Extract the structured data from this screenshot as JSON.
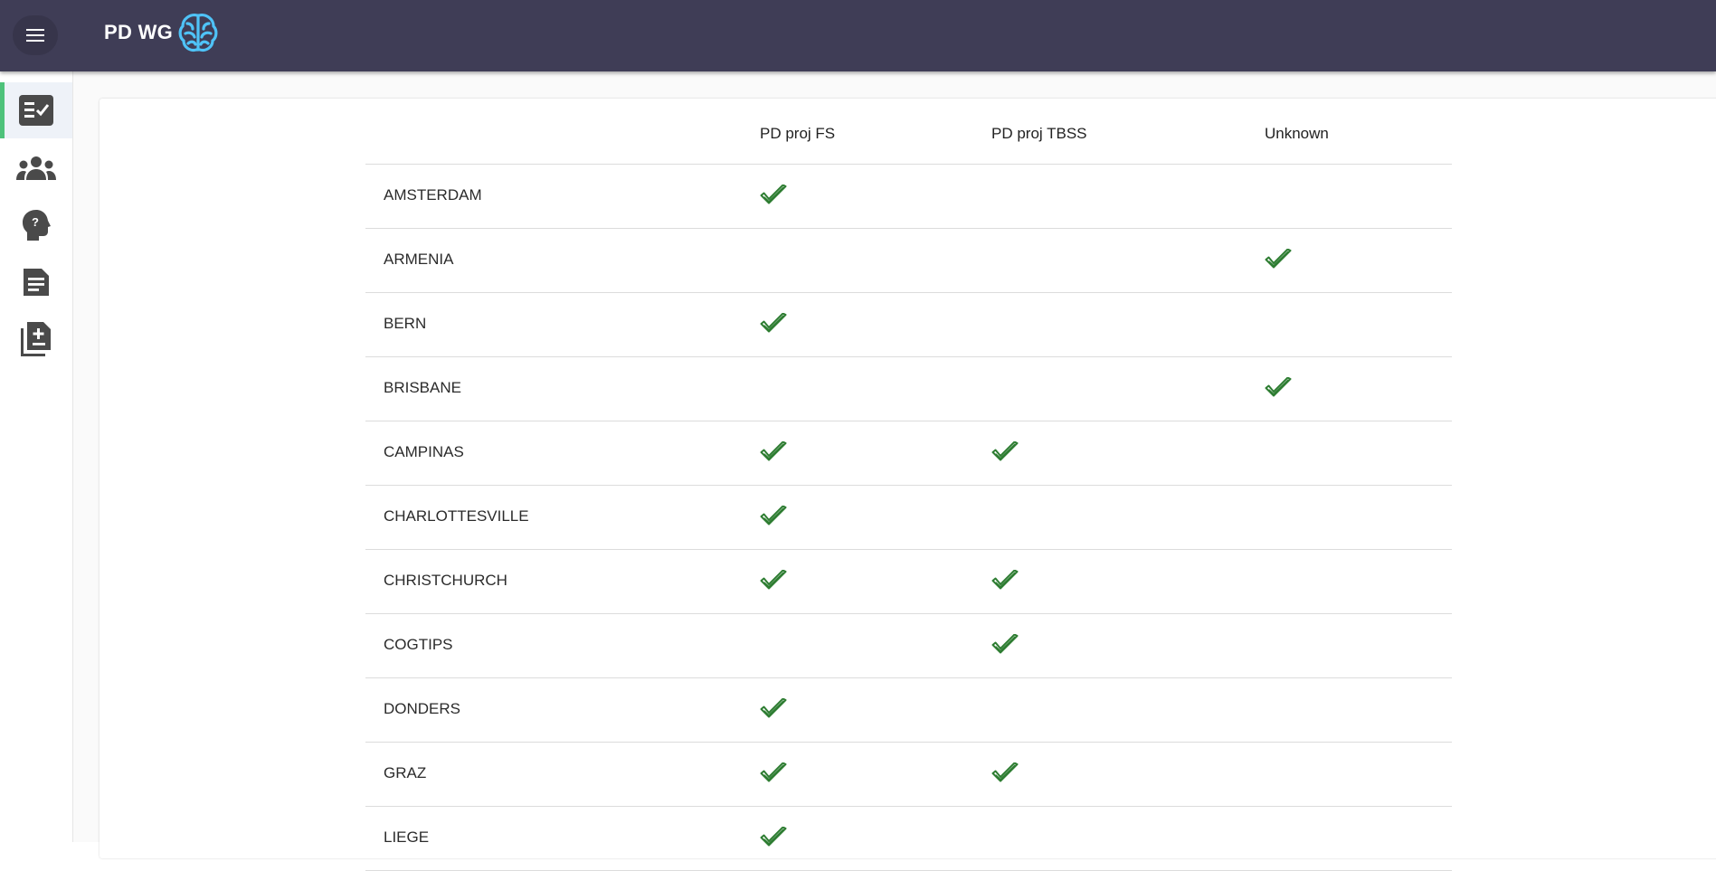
{
  "app": {
    "title": "PD WG"
  },
  "sidebar": {
    "items": [
      {
        "icon": "checklist-icon",
        "active": true
      },
      {
        "icon": "groups-icon",
        "active": false
      },
      {
        "icon": "help-head-icon",
        "active": false
      },
      {
        "icon": "document-icon",
        "active": false
      },
      {
        "icon": "add-documents-icon",
        "active": false
      }
    ]
  },
  "table": {
    "columns": [
      "PD proj FS",
      "PD proj TBSS",
      "Unknown"
    ],
    "rows": [
      {
        "name": "AMSTERDAM",
        "checks": [
          true,
          false,
          false
        ]
      },
      {
        "name": "ARMENIA",
        "checks": [
          false,
          false,
          true
        ]
      },
      {
        "name": "BERN",
        "checks": [
          true,
          false,
          false
        ]
      },
      {
        "name": "BRISBANE",
        "checks": [
          false,
          false,
          true
        ]
      },
      {
        "name": "CAMPINAS",
        "checks": [
          true,
          true,
          false
        ]
      },
      {
        "name": "CHARLOTTESVILLE",
        "checks": [
          true,
          false,
          false
        ]
      },
      {
        "name": "CHRISTCHURCH",
        "checks": [
          true,
          true,
          false
        ]
      },
      {
        "name": "COGTIPS",
        "checks": [
          false,
          true,
          false
        ]
      },
      {
        "name": "DONDERS",
        "checks": [
          true,
          false,
          false
        ]
      },
      {
        "name": "GRAZ",
        "checks": [
          true,
          true,
          false
        ]
      },
      {
        "name": "LIEGE",
        "checks": [
          true,
          false,
          false
        ]
      }
    ]
  },
  "colors": {
    "topbar": "#3f3d56",
    "accent": "#4ec27a",
    "check": "#2e7d32",
    "logo": "#4fc3f7"
  }
}
